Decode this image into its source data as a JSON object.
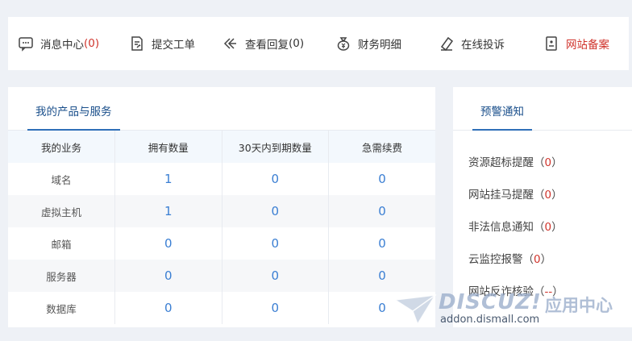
{
  "toolbar": {
    "items": [
      {
        "label": "消息中心",
        "count": "(0)",
        "icon": "message-icon"
      },
      {
        "label": "提交工单",
        "icon": "ticket-icon"
      },
      {
        "label": "查看回复",
        "count": " (0)",
        "icon": "reply-icon"
      },
      {
        "label": "财务明细",
        "icon": "money-bag-icon"
      },
      {
        "label": "在线投诉",
        "icon": "complaint-icon"
      },
      {
        "label": "网站备案",
        "icon": "filing-icon",
        "color": "#d0342c"
      }
    ]
  },
  "products": {
    "title": "我的产品与服务",
    "columns": [
      "我的业务",
      "拥有数量",
      "30天内到期数量",
      "急需续费"
    ],
    "rows": [
      {
        "name": "域名",
        "owned": "1",
        "expiring": "0",
        "urgent": "0"
      },
      {
        "name": "虚拟主机",
        "owned": "1",
        "expiring": "0",
        "urgent": "0"
      },
      {
        "name": "邮箱",
        "owned": "0",
        "expiring": "0",
        "urgent": "0"
      },
      {
        "name": "服务器",
        "owned": "0",
        "expiring": "0",
        "urgent": "0"
      },
      {
        "name": "数据库",
        "owned": "0",
        "expiring": "0",
        "urgent": "0"
      }
    ]
  },
  "alerts": {
    "title": "预警通知",
    "items": [
      {
        "label": "资源超标提醒",
        "open": "（",
        "count": "0",
        "close": "）"
      },
      {
        "label": "网站挂马提醒",
        "open": "（",
        "count": "0",
        "close": "）"
      },
      {
        "label": "非法信息通知",
        "open": "（",
        "count": "0",
        "close": "）"
      },
      {
        "label": "云监控报警",
        "open": "（",
        "count": "0",
        "close": "）"
      },
      {
        "label": "网站反诈核验",
        "open": "（",
        "count": "--",
        "close": "）"
      }
    ]
  },
  "watermark": {
    "logo": "DISCUZ!",
    "logo_cn": "应用中心",
    "url": "addon.dismall.com"
  },
  "colors": {
    "accent": "#2f6fb8",
    "alert_red": "#d0342c",
    "number_blue": "#3b7fd3"
  }
}
